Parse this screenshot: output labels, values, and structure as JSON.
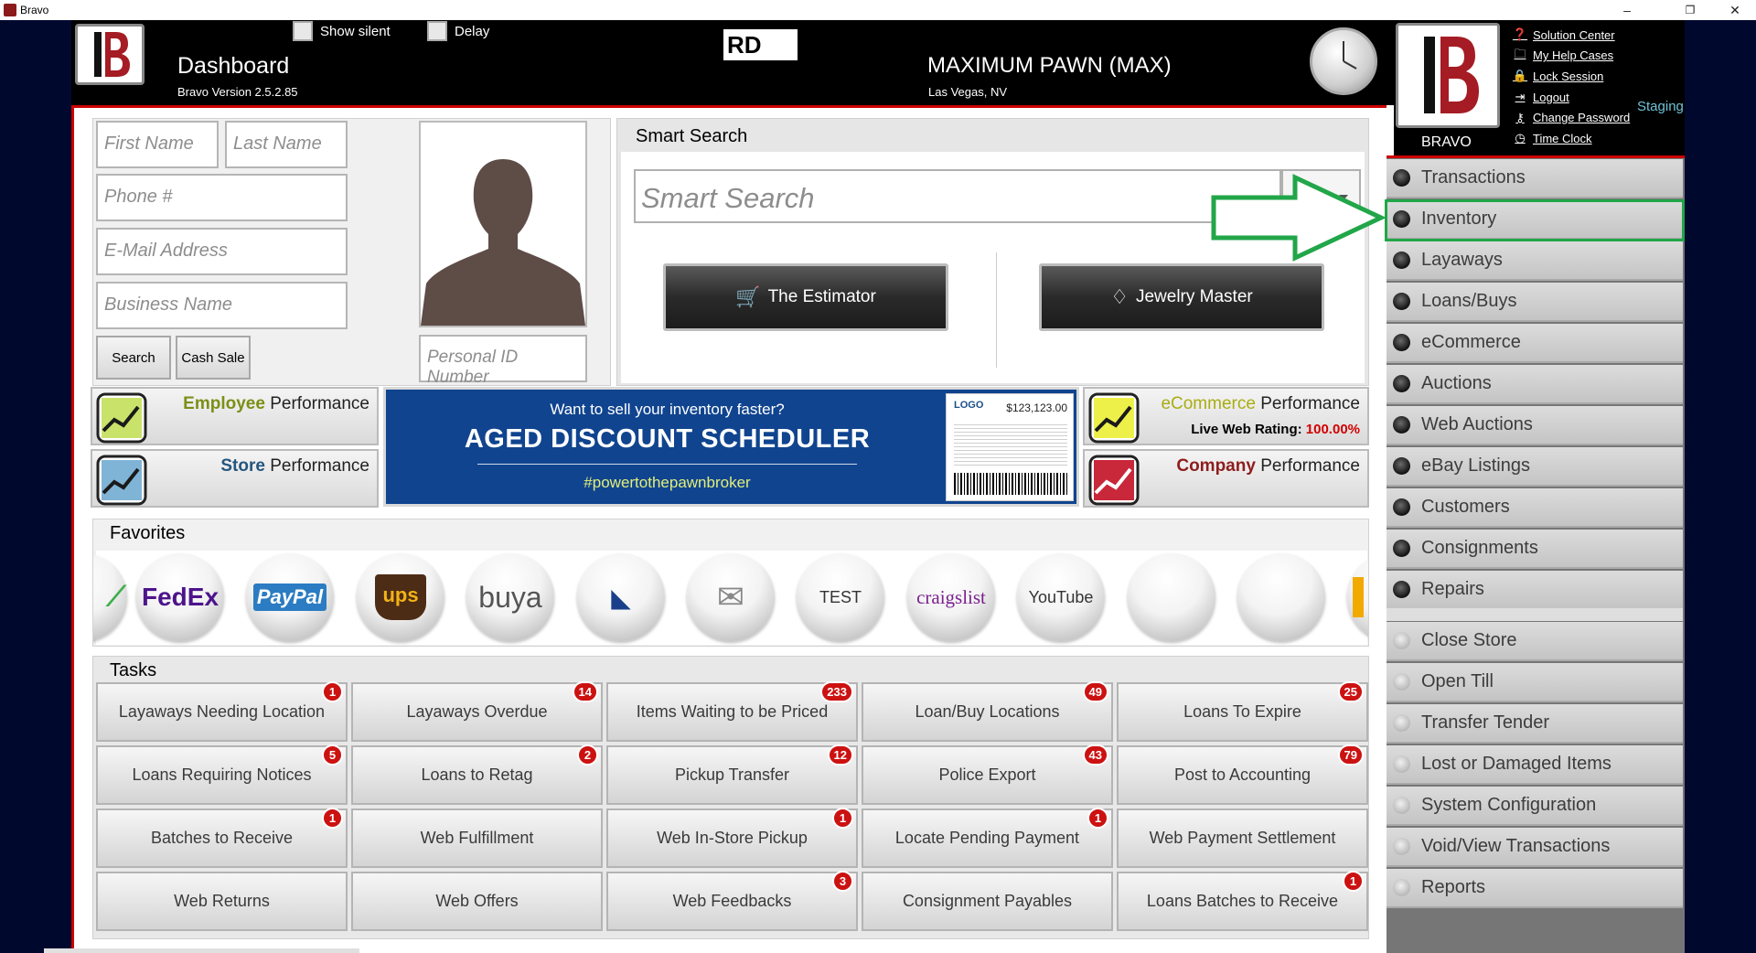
{
  "window": {
    "title": "Bravo",
    "minimize": "–",
    "restore": "❐",
    "close": "✕"
  },
  "header": {
    "title": "Dashboard",
    "version": "Bravo Version 2.5.2.85",
    "show_silent": "Show silent",
    "delay": "Delay",
    "user_initials": "RD",
    "store_name": "MAXIMUM PAWN (MAX)",
    "store_location": "Las Vegas, NV",
    "bravo_label": "BRAVO",
    "staging": "Staging",
    "links": [
      "Solution Center",
      "My Help Cases",
      "Lock Session",
      "Logout",
      "Change Password",
      "Time Clock"
    ]
  },
  "customer": {
    "first_name_placeholder": "First Name",
    "last_name_placeholder": "Last Name",
    "phone_placeholder": "Phone #",
    "email_placeholder": "E-Mail Address",
    "business_placeholder": "Business Name",
    "personal_id_placeholder": "Personal ID Number",
    "search_label": "Search",
    "cash_sale_label": "Cash Sale"
  },
  "smart_search": {
    "title": "Smart Search",
    "placeholder": "Smart Search",
    "estimator_label": "The Estimator",
    "jewelry_label": "Jewelry Master"
  },
  "performance": {
    "employee_accent": "Employee",
    "store_accent": "Store",
    "ecommerce_accent": "eCommerce",
    "company_accent": "Company",
    "word": "Performance",
    "rating_label": "Live Web Rating:",
    "rating_value": "100.00%"
  },
  "banner": {
    "line1": "Want to sell your inventory faster?",
    "line2": "AGED DISCOUNT SCHEDULER",
    "line3": "#powertothepawnbroker",
    "tag_logo": "LOGO",
    "tag_price": "$123,123.00"
  },
  "favorites": {
    "title": "Favorites",
    "items": [
      "",
      "FedEx",
      "PayPal",
      "ups",
      "buya",
      "",
      "",
      "TEST",
      "craigslist",
      "YouTube",
      "",
      "",
      ""
    ]
  },
  "tasks": {
    "title": "Tasks",
    "items": [
      {
        "label": "Layaways Needing Location",
        "badge": "1"
      },
      {
        "label": "Layaways Overdue",
        "badge": "14"
      },
      {
        "label": "Items Waiting to be Priced",
        "badge": "233"
      },
      {
        "label": "Loan/Buy Locations",
        "badge": "49"
      },
      {
        "label": "Loans To Expire",
        "badge": "25"
      },
      {
        "label": "Loans Requiring Notices",
        "badge": "5"
      },
      {
        "label": "Loans to Retag",
        "badge": "2"
      },
      {
        "label": "Pickup Transfer",
        "badge": "12"
      },
      {
        "label": "Police Export",
        "badge": "43"
      },
      {
        "label": "Post to Accounting",
        "badge": "79"
      },
      {
        "label": "Batches to Receive",
        "badge": "1"
      },
      {
        "label": "Web Fulfillment",
        "badge": ""
      },
      {
        "label": "Web In-Store Pickup",
        "badge": "1"
      },
      {
        "label": "Locate Pending Payment",
        "badge": "1"
      },
      {
        "label": "Web Payment Settlement",
        "badge": ""
      },
      {
        "label": "Web Returns",
        "badge": ""
      },
      {
        "label": "Web Offers",
        "badge": ""
      },
      {
        "label": "Web Feedbacks",
        "badge": "3"
      },
      {
        "label": "Consignment Payables",
        "badge": ""
      },
      {
        "label": "Loans Batches to Receive",
        "badge": "1"
      }
    ]
  },
  "menu": {
    "primary": [
      "Transactions",
      "Inventory",
      "Layaways",
      "Loans/Buys",
      "eCommerce",
      "Auctions",
      "Web Auctions",
      "eBay Listings",
      "Customers",
      "Consignments",
      "Repairs"
    ],
    "secondary": [
      "Close Store",
      "Open Till",
      "Transfer Tender",
      "Lost or Damaged Items",
      "System Configuration",
      "Void/View Transactions",
      "Reports"
    ]
  },
  "colors": {
    "accent_red": "#cc0000",
    "highlight_green": "#21a649",
    "badge_red": "#cc1111",
    "banner_blue": "#10448f"
  }
}
